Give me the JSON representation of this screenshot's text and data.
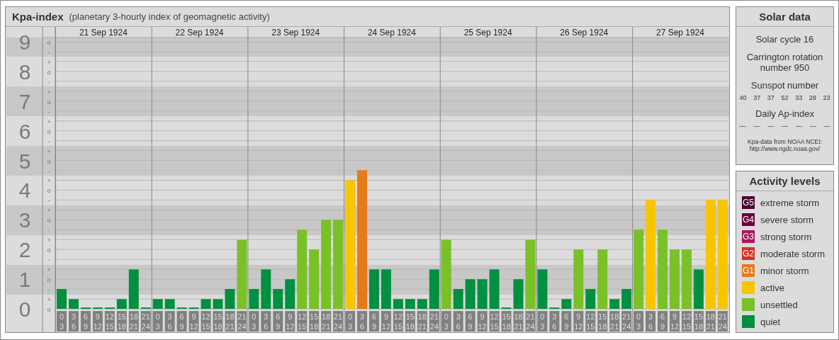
{
  "header": {
    "title": "Kpa-index",
    "subtitle": "(planetary 3-hourly index of geomagnetic activity)"
  },
  "sublevel_marks": [
    "o",
    "-",
    "+",
    "o",
    "-",
    "+",
    "o",
    "-",
    "+",
    "o",
    "-",
    "+",
    "o",
    "-",
    "+",
    "o",
    "-",
    "+",
    "o",
    "-",
    "+",
    "o",
    "-",
    "+",
    "o",
    "-",
    "+",
    "o"
  ],
  "days": [
    {
      "date": "21 Sep 1924",
      "slots": [
        {
          "start": "0",
          "end": "3"
        },
        {
          "start": "3",
          "end": "6"
        },
        {
          "start": "6",
          "end": "9"
        },
        {
          "start": "9",
          "end": "12"
        },
        {
          "start": "12",
          "end": "15"
        },
        {
          "start": "15",
          "end": "18"
        },
        {
          "start": "18",
          "end": "21"
        },
        {
          "start": "21",
          "end": "24"
        }
      ]
    },
    {
      "date": "22 Sep 1924",
      "slots": [
        {
          "start": "0",
          "end": "3"
        },
        {
          "start": "3",
          "end": "6"
        },
        {
          "start": "6",
          "end": "9"
        },
        {
          "start": "9",
          "end": "12"
        },
        {
          "start": "12",
          "end": "15"
        },
        {
          "start": "15",
          "end": "18"
        },
        {
          "start": "18",
          "end": "21"
        },
        {
          "start": "21",
          "end": "24"
        }
      ]
    },
    {
      "date": "23 Sep 1924",
      "slots": [
        {
          "start": "0",
          "end": "3"
        },
        {
          "start": "3",
          "end": "6"
        },
        {
          "start": "6",
          "end": "9"
        },
        {
          "start": "9",
          "end": "12"
        },
        {
          "start": "12",
          "end": "15"
        },
        {
          "start": "15",
          "end": "18"
        },
        {
          "start": "18",
          "end": "21"
        },
        {
          "start": "21",
          "end": "24"
        }
      ]
    },
    {
      "date": "24 Sep 1924",
      "slots": [
        {
          "start": "0",
          "end": "3"
        },
        {
          "start": "3",
          "end": "6"
        },
        {
          "start": "6",
          "end": "9"
        },
        {
          "start": "9",
          "end": "12"
        },
        {
          "start": "12",
          "end": "15"
        },
        {
          "start": "15",
          "end": "18"
        },
        {
          "start": "18",
          "end": "21"
        },
        {
          "start": "21",
          "end": "24"
        }
      ]
    },
    {
      "date": "25 Sep 1924",
      "slots": [
        {
          "start": "0",
          "end": "3"
        },
        {
          "start": "3",
          "end": "6"
        },
        {
          "start": "6",
          "end": "9"
        },
        {
          "start": "9",
          "end": "12"
        },
        {
          "start": "12",
          "end": "15"
        },
        {
          "start": "15",
          "end": "18"
        },
        {
          "start": "18",
          "end": "21"
        },
        {
          "start": "21",
          "end": "24"
        }
      ]
    },
    {
      "date": "26 Sep 1924",
      "slots": [
        {
          "start": "0",
          "end": "3"
        },
        {
          "start": "3",
          "end": "6"
        },
        {
          "start": "6",
          "end": "9"
        },
        {
          "start": "9",
          "end": "12"
        },
        {
          "start": "12",
          "end": "15"
        },
        {
          "start": "15",
          "end": "18"
        },
        {
          "start": "18",
          "end": "21"
        },
        {
          "start": "21",
          "end": "24"
        }
      ]
    },
    {
      "date": "27 Sep 1924",
      "slots": [
        {
          "start": "0",
          "end": "3"
        },
        {
          "start": "3",
          "end": "6"
        },
        {
          "start": "6",
          "end": "9"
        },
        {
          "start": "9",
          "end": "12"
        },
        {
          "start": "12",
          "end": "15"
        },
        {
          "start": "15",
          "end": "18"
        },
        {
          "start": "18",
          "end": "21"
        },
        {
          "start": "21",
          "end": "24"
        }
      ]
    }
  ],
  "chart_data": {
    "type": "bar",
    "ylim": [
      0,
      9
    ],
    "grid": true,
    "yticks": [
      9,
      8,
      7,
      6,
      5,
      4,
      3,
      2,
      1,
      0
    ],
    "series": [
      {
        "color": "#009040",
        "values": [
          0.67,
          0.33,
          0,
          0,
          0,
          0.33,
          1.33,
          0,
          0.33,
          0.33,
          0,
          0,
          0.33,
          0.33,
          0.67,
          null,
          0.67,
          1.33,
          0.67,
          1,
          null,
          null,
          null,
          null,
          null,
          null,
          1.33,
          1.33,
          0.33,
          0.33,
          0.33,
          1.33,
          null,
          0.67,
          1,
          1,
          1.33,
          0,
          1,
          null,
          1.33,
          0,
          0.33,
          null,
          0.67,
          null,
          0.33,
          0.67,
          null,
          null,
          null,
          null,
          null,
          1.33,
          null,
          null
        ]
      },
      {
        "color": "#7ac027",
        "values": [
          null,
          null,
          null,
          null,
          null,
          null,
          null,
          null,
          null,
          null,
          null,
          null,
          null,
          null,
          null,
          2.33,
          null,
          null,
          null,
          null,
          2.67,
          2,
          3,
          3,
          null,
          null,
          null,
          null,
          null,
          null,
          null,
          null,
          2.33,
          null,
          null,
          null,
          null,
          null,
          null,
          2.33,
          null,
          null,
          null,
          2,
          null,
          2,
          null,
          null,
          2.67,
          null,
          2.67,
          2,
          2,
          null,
          null,
          null
        ]
      },
      {
        "color": "#f8c600",
        "values": [
          null,
          null,
          null,
          null,
          null,
          null,
          null,
          null,
          null,
          null,
          null,
          null,
          null,
          null,
          null,
          null,
          null,
          null,
          null,
          null,
          null,
          null,
          null,
          null,
          4.33,
          null,
          null,
          null,
          null,
          null,
          null,
          null,
          null,
          null,
          null,
          null,
          null,
          null,
          null,
          null,
          null,
          null,
          null,
          null,
          null,
          null,
          null,
          null,
          null,
          3.67,
          null,
          null,
          null,
          null,
          3.67,
          3.67
        ]
      },
      {
        "color": "#e67a1a",
        "values": [
          null,
          null,
          null,
          null,
          null,
          null,
          null,
          null,
          null,
          null,
          null,
          null,
          null,
          null,
          null,
          null,
          null,
          null,
          null,
          null,
          null,
          null,
          null,
          null,
          null,
          4.67,
          null,
          null,
          null,
          null,
          null,
          null,
          null,
          null,
          null,
          null,
          null,
          null,
          null,
          null,
          null,
          null,
          null,
          null,
          null,
          null,
          null,
          null,
          null,
          null,
          null,
          null,
          null,
          null,
          null,
          null
        ]
      }
    ]
  },
  "solar_data": {
    "title": "Solar data",
    "cycle": "Solar cycle 16",
    "rotation": "Carrington rotation number 950",
    "sunspot_label": "Sunspot number",
    "sunspots": [
      "40",
      "37",
      "37",
      "52",
      "33",
      "28",
      "23"
    ],
    "ap_label": "Daily Ap-index",
    "ap_values": [
      "—",
      "—",
      "—",
      "—",
      "—",
      "—",
      "—"
    ],
    "source": "Kpa-data from NOAA NCEI:",
    "source_url": "http://www.ngdc.noaa.gov/"
  },
  "activity_levels": {
    "title": "Activity levels",
    "items": [
      {
        "badge": "G5",
        "label": "extreme storm",
        "color": "#4a0030"
      },
      {
        "badge": "G4",
        "label": "severe storm",
        "color": "#6a0040"
      },
      {
        "badge": "G3",
        "label": "strong storm",
        "color": "#b0145e"
      },
      {
        "badge": "G2",
        "label": "moderate storm",
        "color": "#d8301e"
      },
      {
        "badge": "G1",
        "label": "minor storm",
        "color": "#e67a1a"
      },
      {
        "label": "active",
        "color": "#f8c600"
      },
      {
        "label": "unsettled",
        "color": "#7ac027"
      },
      {
        "label": "quiet",
        "color": "#009040"
      }
    ]
  }
}
